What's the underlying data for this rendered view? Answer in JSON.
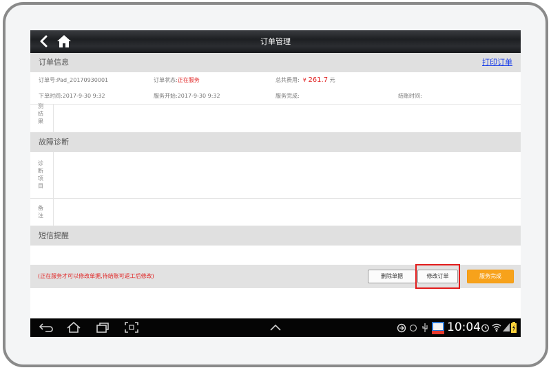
{
  "header": {
    "title": "订单管理"
  },
  "order_info": {
    "section_label": "订单信息",
    "print_label": "打印订单",
    "order_no": "订单号:Pad_20170930001",
    "status_label": "订单状态:",
    "status_value": "正在服务",
    "total_label": "总共费用:",
    "currency": "¥",
    "total_value": "261.7",
    "total_unit": "元",
    "order_time": "下单时间:2017-9-30 9:32",
    "service_start": "服务开始:2017-9-30 9:32",
    "service_done": "服务完成:",
    "checkout_time": "结账时间:",
    "result_label": "测结果"
  },
  "diagnosis": {
    "section_label": "故障诊断",
    "items_label": "诊断项目",
    "remarks_label": "备注"
  },
  "sms": {
    "section_label": "短信提醒"
  },
  "actions": {
    "hint": "(正在服务才可以修改单据,待结账可返工后修改)",
    "delete_label": "删除单据",
    "modify_label": "修改订单",
    "complete_label": "服务完成"
  },
  "system": {
    "clock": "10:04"
  }
}
